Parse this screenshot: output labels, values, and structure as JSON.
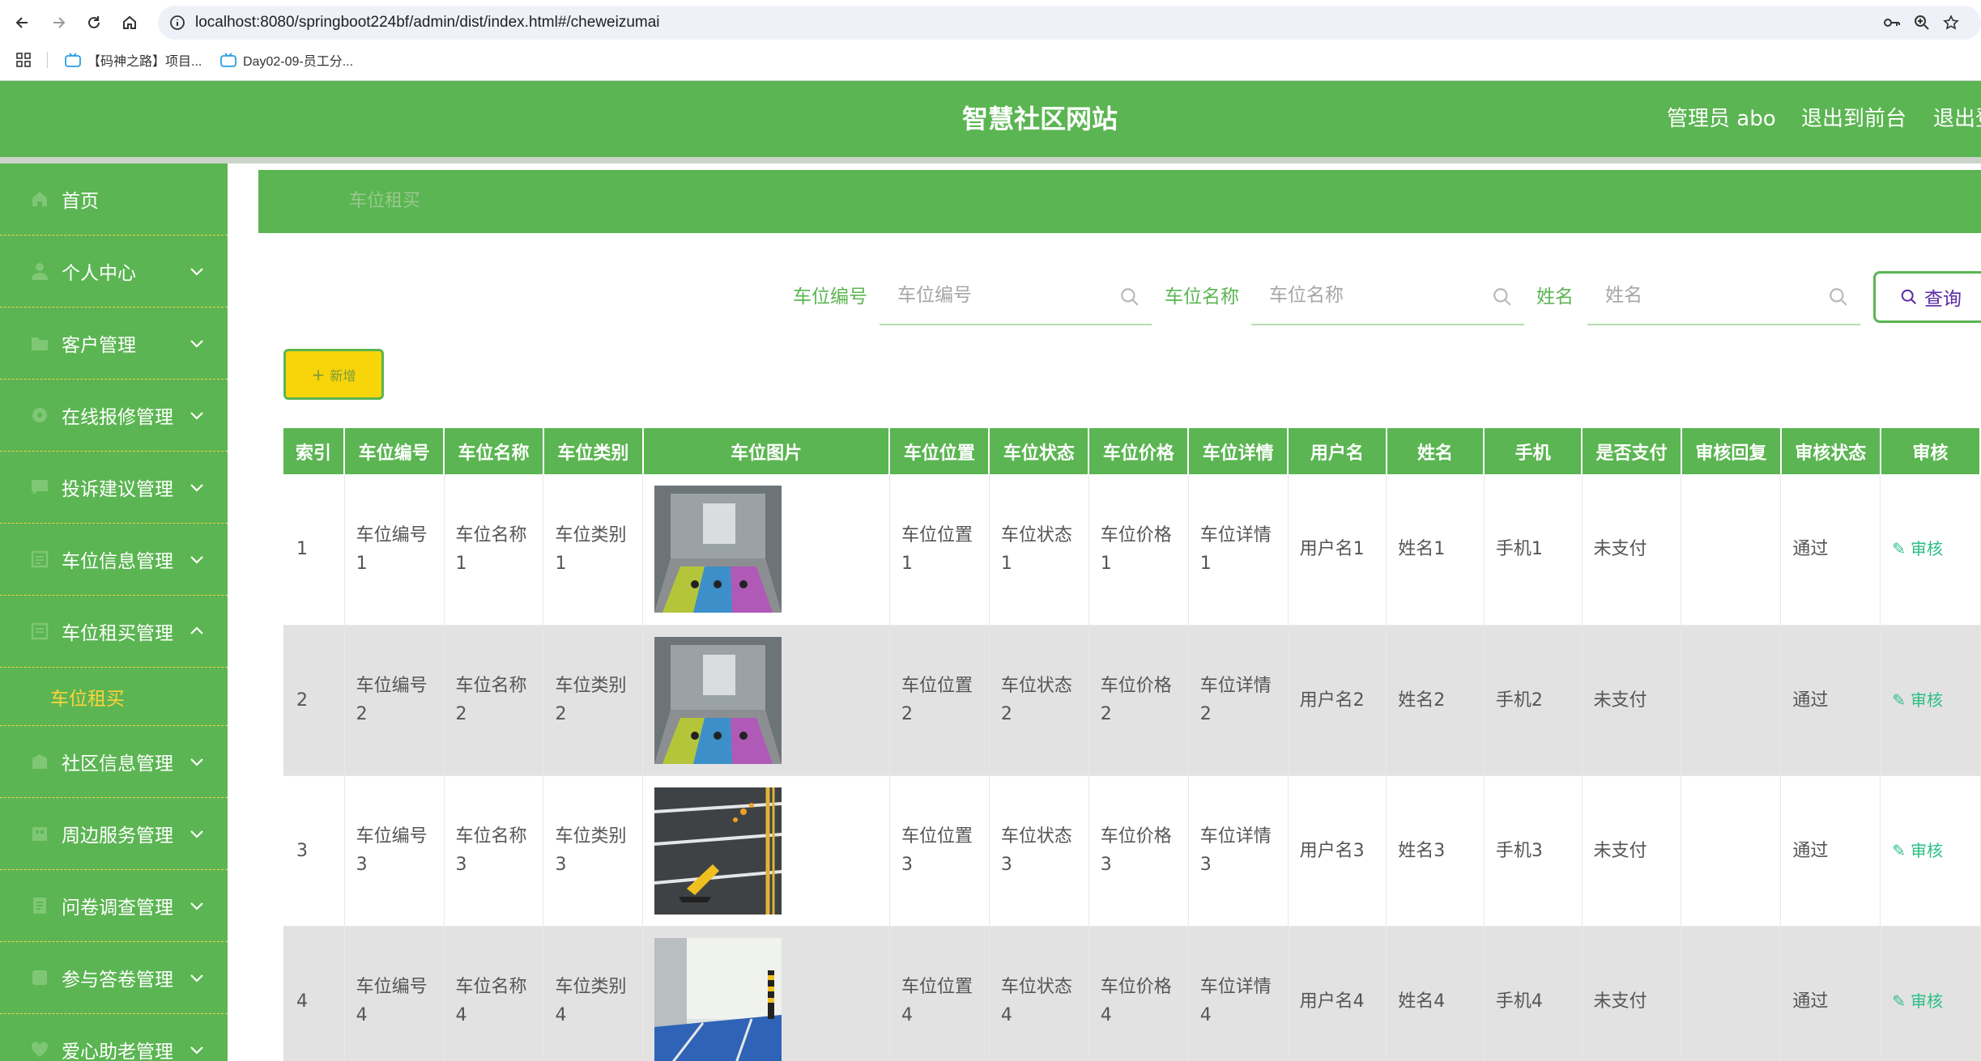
{
  "browser": {
    "url": "localhost:8080/springboot224bf/admin/dist/index.html#/cheweizumai",
    "bookmarks": [
      {
        "label": "【码神之路】项目..."
      },
      {
        "label": "Day02-09-员工分..."
      }
    ]
  },
  "header": {
    "title": "智慧社区网站",
    "admin_label": "管理员 abo",
    "exit_front": "退出到前台",
    "logout": "退出登录"
  },
  "sidebar": {
    "items": [
      {
        "label": "首页",
        "icon": "home-icon",
        "expandable": false
      },
      {
        "label": "个人中心",
        "icon": "user-icon",
        "expandable": true
      },
      {
        "label": "客户管理",
        "icon": "folder-icon",
        "expandable": true
      },
      {
        "label": "在线报修管理",
        "icon": "tool-icon",
        "expandable": true
      },
      {
        "label": "投诉建议管理",
        "icon": "message-icon",
        "expandable": true
      },
      {
        "label": "车位信息管理",
        "icon": "list-icon",
        "expandable": true
      },
      {
        "label": "车位租买管理",
        "icon": "list-icon",
        "expandable": true,
        "expanded": true
      },
      {
        "label": "社区信息管理",
        "icon": "building-icon",
        "expandable": true
      },
      {
        "label": "周边服务管理",
        "icon": "shop-icon",
        "expandable": true
      },
      {
        "label": "问卷调查管理",
        "icon": "survey-icon",
        "expandable": true
      },
      {
        "label": "参与答卷管理",
        "icon": "pen-icon",
        "expandable": true
      },
      {
        "label": "爱心助老管理",
        "icon": "heart-icon",
        "expandable": true
      }
    ],
    "submenu": {
      "label": "车位租买"
    }
  },
  "breadcrumb": "车位租买",
  "search": {
    "fields": [
      {
        "label": "车位编号",
        "placeholder": "车位编号"
      },
      {
        "label": "车位名称",
        "placeholder": "车位名称"
      },
      {
        "label": "姓名",
        "placeholder": "姓名"
      }
    ],
    "query_label": "查询"
  },
  "add_label": "新增",
  "table": {
    "columns": [
      "索引",
      "车位编号",
      "车位名称",
      "车位类别",
      "车位图片",
      "车位位置",
      "车位状态",
      "车位价格",
      "车位详情",
      "用户名",
      "姓名",
      "手机",
      "是否支付",
      "审核回复",
      "审核状态",
      "审核"
    ],
    "rows": [
      {
        "index": "1",
        "code": "车位编号1",
        "name": "车位名称1",
        "category": "车位类别1",
        "image": "garage-lanes",
        "location": "车位位置1",
        "status": "车位状态1",
        "price": "车位价格1",
        "detail": "车位详情1",
        "username": "用户名1",
        "realname": "姓名1",
        "phone": "手机1",
        "paid": "未支付",
        "reply": "",
        "review": "通过",
        "action": "审核"
      },
      {
        "index": "2",
        "code": "车位编号2",
        "name": "车位名称2",
        "category": "车位类别2",
        "image": "garage-lanes",
        "location": "车位位置2",
        "status": "车位状态2",
        "price": "车位价格2",
        "detail": "车位详情2",
        "username": "用户名2",
        "realname": "姓名2",
        "phone": "手机2",
        "paid": "未支付",
        "reply": "",
        "review": "通过",
        "action": "审核"
      },
      {
        "index": "3",
        "code": "车位编号3",
        "name": "车位名称3",
        "category": "车位类别3",
        "image": "parking-lock",
        "location": "车位位置3",
        "status": "车位状态3",
        "price": "车位价格3",
        "detail": "车位详情3",
        "username": "用户名3",
        "realname": "姓名3",
        "phone": "手机3",
        "paid": "未支付",
        "reply": "",
        "review": "通过",
        "action": "审核"
      },
      {
        "index": "4",
        "code": "车位编号4",
        "name": "车位名称4",
        "category": "车位类别4",
        "image": "blue-floor",
        "location": "车位位置4",
        "status": "车位状态4",
        "price": "车位价格4",
        "detail": "车位详情4",
        "username": "用户名4",
        "realname": "姓名4",
        "phone": "手机4",
        "paid": "未支付",
        "reply": "",
        "review": "通过",
        "action": "审核"
      }
    ]
  },
  "colors": {
    "primary": "#5bb552",
    "accent_yellow": "#f8d40a",
    "submenu_text": "#ffd23a",
    "action_text": "#2bbf86"
  }
}
